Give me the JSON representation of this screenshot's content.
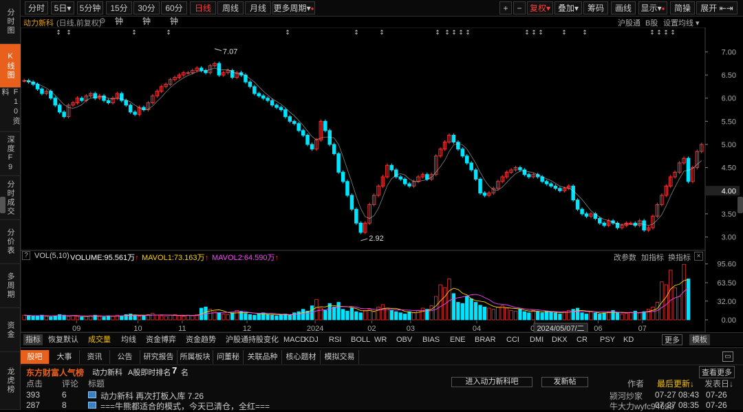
{
  "left_nav": [
    {
      "label": "分时图",
      "active": false
    },
    {
      "label": "K线图",
      "active": true
    },
    {
      "label": "F10资料",
      "active": false
    },
    {
      "label": "深度F9",
      "active": false
    },
    {
      "label": "分时成交",
      "active": false
    },
    {
      "label": "分价表",
      "active": false
    },
    {
      "label": "多周期",
      "active": false
    },
    {
      "label": "资金",
      "active": false
    },
    {
      "label": "龙虎榜",
      "active": false
    }
  ],
  "toolbar": {
    "periods": [
      "分时",
      "5日",
      "5分钟",
      "15分钟",
      "30分钟",
      "60分钟",
      "日线",
      "周线",
      "月线",
      "更多周期"
    ],
    "active_period": "日线",
    "plus": "+",
    "minus": "−",
    "fuquan": "复权",
    "diejia": "叠加",
    "chouma": "筹码",
    "huaxian": "画线",
    "xianshi": "显示",
    "jiancao": "简操",
    "zhankai": "展开"
  },
  "stock": {
    "name": "动力新科",
    "mode": "(日线,前复权)"
  },
  "subhdr_right": {
    "hgt": "沪股通",
    "bgu": "B股",
    "set_ma": "设置均线"
  },
  "chart_data": {
    "type": "candlestick",
    "ylim": [
      2.8,
      7.2
    ],
    "y_ticks": [
      "7.00",
      "6.50",
      "6.00",
      "5.50",
      "5.00",
      "4.50",
      "4.00",
      "3.50",
      "3.00"
    ],
    "current_price": "4.00",
    "high_label": "7.07",
    "low_label": "2.92",
    "x_labels": [
      "09",
      "10",
      "11",
      "12",
      "2024",
      "02",
      "03",
      "04",
      "05",
      "06",
      "07"
    ],
    "date_tip": "2024/05/07/二",
    "closes": [
      6.38,
      6.35,
      6.3,
      6.2,
      6.1,
      6.15,
      6.0,
      5.85,
      5.7,
      5.6,
      5.85,
      5.9,
      6.0,
      5.95,
      6.05,
      6.1,
      6.0,
      6.05,
      5.95,
      5.9,
      6.0,
      6.1,
      5.95,
      5.85,
      5.7,
      5.65,
      5.8,
      5.75,
      5.9,
      6.05,
      6.15,
      6.25,
      6.3,
      6.4,
      6.45,
      6.5,
      6.55,
      6.55,
      6.6,
      6.65,
      6.6,
      6.55,
      6.7,
      6.75,
      6.5,
      6.55,
      6.6,
      6.45,
      6.55,
      6.5,
      6.35,
      6.25,
      6.1,
      6.05,
      6.0,
      5.95,
      5.85,
      5.8,
      5.75,
      5.6,
      5.5,
      5.45,
      5.3,
      5.2,
      5.0,
      4.9,
      5.1,
      5.5,
      5.3,
      5.0,
      4.8,
      4.4,
      4.2,
      3.9,
      3.6,
      3.3,
      3.1,
      3.3,
      3.7,
      3.9,
      4.1,
      4.3,
      4.55,
      4.45,
      4.3,
      4.25,
      4.15,
      4.1,
      4.2,
      4.3,
      4.35,
      4.25,
      4.35,
      4.75,
      4.9,
      5.05,
      5.2,
      5.05,
      4.9,
      4.75,
      4.6,
      4.45,
      4.25,
      3.95,
      3.9,
      3.95,
      4.05,
      4.2,
      4.3,
      4.4,
      4.45,
      4.5,
      4.45,
      4.35,
      4.3,
      4.35,
      4.3,
      4.2,
      4.15,
      4.1,
      4.05,
      4.0,
      4.05,
      4.1,
      3.8,
      3.6,
      3.5,
      3.45,
      3.5,
      3.4,
      3.3,
      3.25,
      3.35,
      3.3,
      3.2,
      3.25,
      3.3,
      3.3,
      3.25,
      3.35,
      3.15,
      3.2,
      3.45,
      3.7,
      3.9,
      4.1,
      4.3,
      4.4,
      4.6,
      4.7,
      4.2,
      4.5,
      4.85,
      5.0
    ],
    "volumes": [
      8,
      7,
      6,
      7,
      8,
      6,
      5,
      7,
      9,
      8,
      6,
      7,
      6,
      5,
      6,
      7,
      8,
      6,
      5,
      7,
      6,
      8,
      7,
      9,
      10,
      8,
      6,
      7,
      9,
      11,
      8,
      7,
      6,
      8,
      9,
      7,
      6,
      8,
      7,
      9,
      20,
      22,
      18,
      14,
      12,
      10,
      9,
      12,
      16,
      14,
      11,
      9,
      8,
      10,
      12,
      9,
      8,
      7,
      9,
      10,
      8,
      12,
      14,
      18,
      15,
      24,
      35,
      20,
      16,
      28,
      22,
      30,
      18,
      15,
      20,
      14,
      12,
      16,
      18,
      14,
      22,
      26,
      20,
      16,
      14,
      12,
      10,
      14,
      12,
      16,
      20,
      18,
      24,
      40,
      60,
      55,
      70,
      45,
      30,
      28,
      40,
      36,
      30,
      25,
      22,
      20,
      18,
      22,
      24,
      20,
      16,
      15,
      18,
      14,
      12,
      16,
      14,
      12,
      15,
      13,
      12,
      10,
      14,
      16,
      18,
      20,
      12,
      10,
      14,
      12,
      10,
      12,
      14,
      16,
      12,
      10,
      11,
      13,
      15,
      12,
      14,
      18,
      22,
      30,
      65,
      60,
      85,
      55,
      40,
      95,
      70
    ]
  },
  "volume_bar": {
    "title": "VOL(5,10)",
    "volume": "VOLUME:95.561万",
    "mavol1": "MAVOL1:73.163万",
    "mavol2": "MAVOL2:64.590万",
    "gaicanshu": "改参数",
    "jiazhibiao": "加指标",
    "huanzhibiao": "换指标",
    "ticks": [
      "95.60",
      "63.50",
      "32.00",
      "0.00"
    ]
  },
  "ind_tabs": [
    "指标",
    "恢复默认",
    "成交量",
    "均线",
    "资金博弈",
    "资金趋势",
    "沪股通持股变化",
    "MACD",
    "KDJ",
    "RSI",
    "BOLL",
    "WR",
    "OBV",
    "BIAS",
    "ENE",
    "BRAR",
    "CCI",
    "DMI",
    "DKX",
    "CR",
    "PSY",
    "KD",
    "更多",
    "模板"
  ],
  "bottom_tabs": [
    "股吧",
    "大事",
    "资讯",
    "公告",
    "研究报告",
    "所属板块",
    "问董秘",
    "关联品种",
    "核心题材",
    "模拟交易"
  ],
  "guba": {
    "brand": "东方财富人气榜",
    "stock": "动力新科",
    "rank_label": "A股即时排名",
    "rank": "7",
    "rank_unit": "名",
    "view_more": "查看更多",
    "cols": {
      "clicks": "点击",
      "comments": "评论",
      "title": "标题",
      "author": "作者",
      "updated": "最后更新↓",
      "posted": "发表日↓"
    },
    "enter_btn": "进入动力新科吧",
    "post_btn": "发新帖",
    "posts": [
      {
        "clicks": "393",
        "comments": "6",
        "title": "动力新科 再次打板入库  7.26",
        "author": "颍河炒家",
        "updated": "07-27 08:43",
        "posted": "07-26"
      },
      {
        "clicks": "287",
        "comments": "8",
        "title": "===牛熊都适合的模式，今天已清仓，全红===",
        "author": "牛大力wyfc94628",
        "updated": "07-27 08:35",
        "posted": "07-26"
      }
    ]
  },
  "colors": {
    "up": "#ff3232",
    "down": "#00e5ff",
    "accent": "#e8601c",
    "ma1": "#ffffff",
    "ma2": "#ffd700",
    "ma3": "#ff44ff"
  }
}
